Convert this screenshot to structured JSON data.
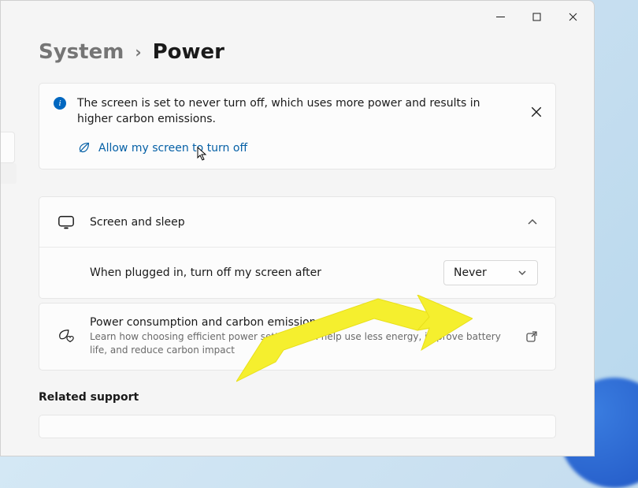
{
  "breadcrumb": {
    "parent": "System",
    "current": "Power"
  },
  "info_banner": {
    "message": "The screen is set to never turn off, which uses more power and results in higher carbon emissions.",
    "action_label": "Allow my screen to turn off"
  },
  "screen_sleep": {
    "header": "Screen and sleep",
    "plugged_label": "When plugged in, turn off my screen after",
    "plugged_value": "Never"
  },
  "power_consumption": {
    "title": "Power consumption and carbon emissions",
    "subtitle": "Learn how choosing efficient power settings can help use less energy, improve battery life, and reduce carbon impact"
  },
  "related_support": {
    "heading": "Related support"
  }
}
